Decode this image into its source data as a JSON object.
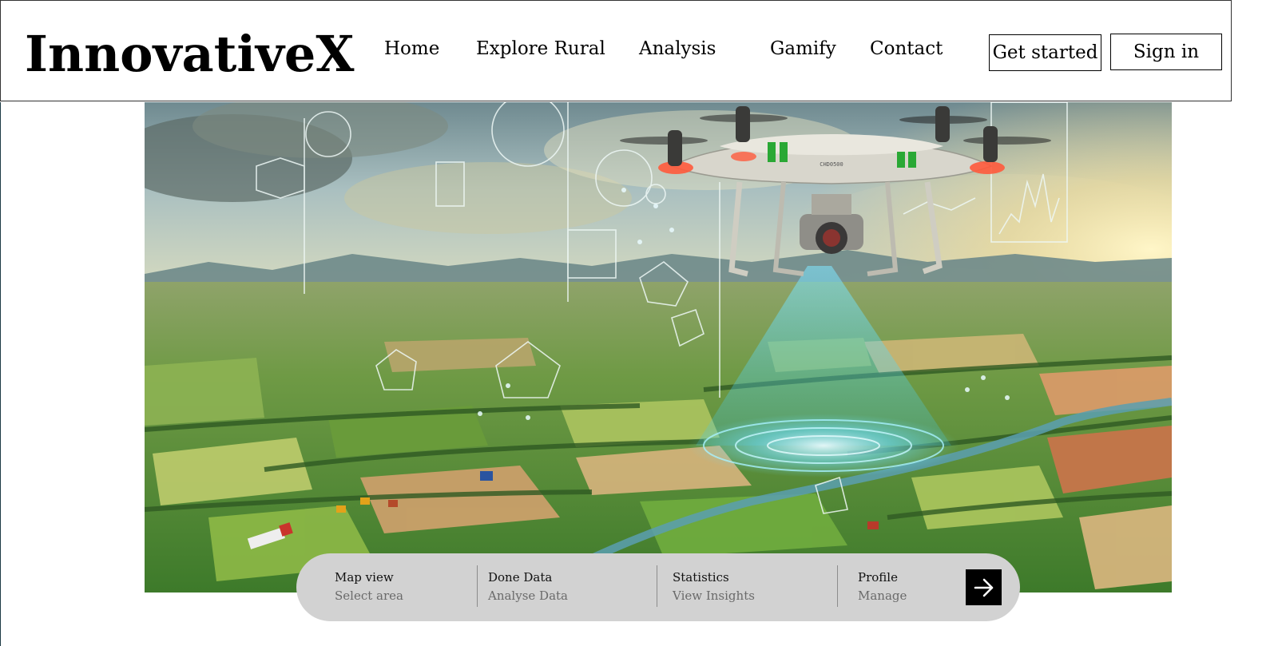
{
  "brand": {
    "logo_text": "InnovativeX"
  },
  "nav": {
    "links": [
      {
        "label": "Home"
      },
      {
        "label": "Explore Rural"
      },
      {
        "label": "Analysis"
      },
      {
        "label": "Gamify"
      },
      {
        "label": "Contact"
      }
    ],
    "get_started_label": "Get started",
    "sign_in_label": "Sign in"
  },
  "hero": {
    "description": "Aerial farmland with drone scanning and data overlays",
    "drone_label": "CHD0500",
    "colors": {
      "sky": "#9fb6b8",
      "field_green": "#5f9a38",
      "scan_beam": "#4fd6f0",
      "sun": "#fbe9a6"
    }
  },
  "quick_bar": {
    "items": [
      {
        "title": "Map view",
        "subtitle": "Select area"
      },
      {
        "title": "Done Data",
        "subtitle": "Analyse Data"
      },
      {
        "title": "Statistics",
        "subtitle": "View Insights"
      },
      {
        "title": "Profile",
        "subtitle": "Manage"
      }
    ],
    "go_icon": "arrow-right-icon"
  }
}
